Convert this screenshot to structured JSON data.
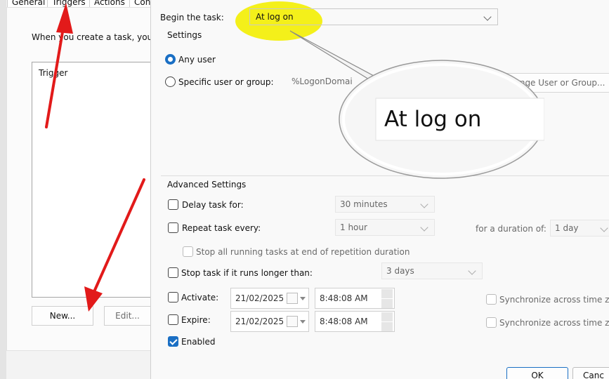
{
  "left": {
    "tabs": [
      "General",
      "Triggers",
      "Actions",
      "Con"
    ],
    "intro_text": "When you create a task, you c",
    "list_header": "Trigger",
    "new_button": "New...",
    "edit_button": "Edit..."
  },
  "dialog": {
    "begin_label": "Begin the task:",
    "begin_value": "At log on",
    "settings_label": "Settings",
    "any_user": "Any user",
    "specific_user": "Specific user or group:",
    "logon_domain": "%LogonDomai",
    "change_user_button": "Change User or Group...",
    "magnified_text": "At log on",
    "advanced_label": "Advanced Settings",
    "delay_label": "Delay task for:",
    "delay_value": "30 minutes",
    "repeat_label": "Repeat task every:",
    "repeat_value": "1 hour",
    "duration_label": "for a duration of:",
    "duration_value": "1 day",
    "stop_running_label": "Stop all running tasks at end of repetition duration",
    "stop_longer_label": "Stop task if it runs longer than:",
    "stop_longer_value": "3 days",
    "activate_label": "Activate:",
    "activate_date": "21/02/2025",
    "activate_time": "8:48:08 AM",
    "expire_label": "Expire:",
    "expire_date": "21/02/2025",
    "expire_time": "8:48:08 AM",
    "sync_label_1": "Synchronize across time zon",
    "sync_label_2": "Synchronize across time zon",
    "enabled_label": "Enabled",
    "ok_button": "OK",
    "cancel_button": "Canc"
  },
  "colors": {
    "highlight": "#f4f01a",
    "arrow": "#e21a1a",
    "accent": "#1a6fc4"
  }
}
